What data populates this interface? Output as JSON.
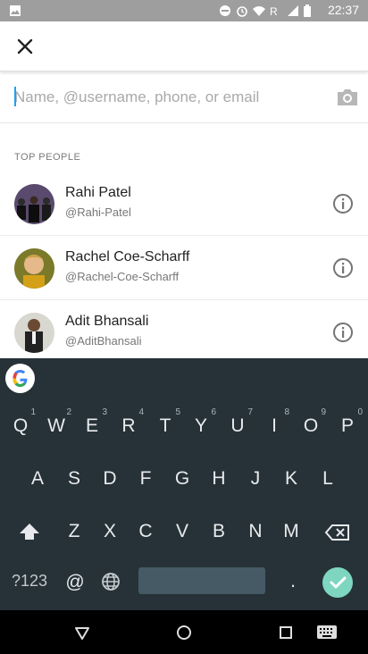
{
  "status_bar": {
    "time": "22:37",
    "icons": [
      "image-icon",
      "do-not-disturb-icon",
      "alarm-icon",
      "wifi-icon",
      "roaming-icon",
      "signal-icon",
      "battery-icon"
    ]
  },
  "toolbar": {
    "close_icon": "close-icon"
  },
  "search": {
    "value": "",
    "placeholder": "Name, @username, phone, or email",
    "camera_icon": "camera-icon"
  },
  "section": {
    "title": "TOP PEOPLE"
  },
  "people": [
    {
      "name": "Rahi Patel",
      "handle": "@Rahi-Patel"
    },
    {
      "name": "Rachel Coe-Scharff",
      "handle": "@Rachel-Coe-Scharff"
    },
    {
      "name": "Adit Bhansali",
      "handle": "@AditBhansali"
    }
  ],
  "keyboard": {
    "row1": [
      {
        "k": "Q",
        "h": "1"
      },
      {
        "k": "W",
        "h": "2"
      },
      {
        "k": "E",
        "h": "3"
      },
      {
        "k": "R",
        "h": "4"
      },
      {
        "k": "T",
        "h": "5"
      },
      {
        "k": "Y",
        "h": "6"
      },
      {
        "k": "U",
        "h": "7"
      },
      {
        "k": "I",
        "h": "8"
      },
      {
        "k": "O",
        "h": "9"
      },
      {
        "k": "P",
        "h": "0"
      }
    ],
    "row2": [
      "A",
      "S",
      "D",
      "F",
      "G",
      "H",
      "J",
      "K",
      "L"
    ],
    "row3": [
      "Z",
      "X",
      "C",
      "V",
      "B",
      "N",
      "M"
    ],
    "symbols_key": "?123",
    "at_key": "@",
    "period_key": "."
  },
  "colors": {
    "accent": "#1da1f2",
    "keyboard_bg": "#263238",
    "enter_key": "#7ed6c0",
    "status_bar": "#9e9e9e"
  }
}
